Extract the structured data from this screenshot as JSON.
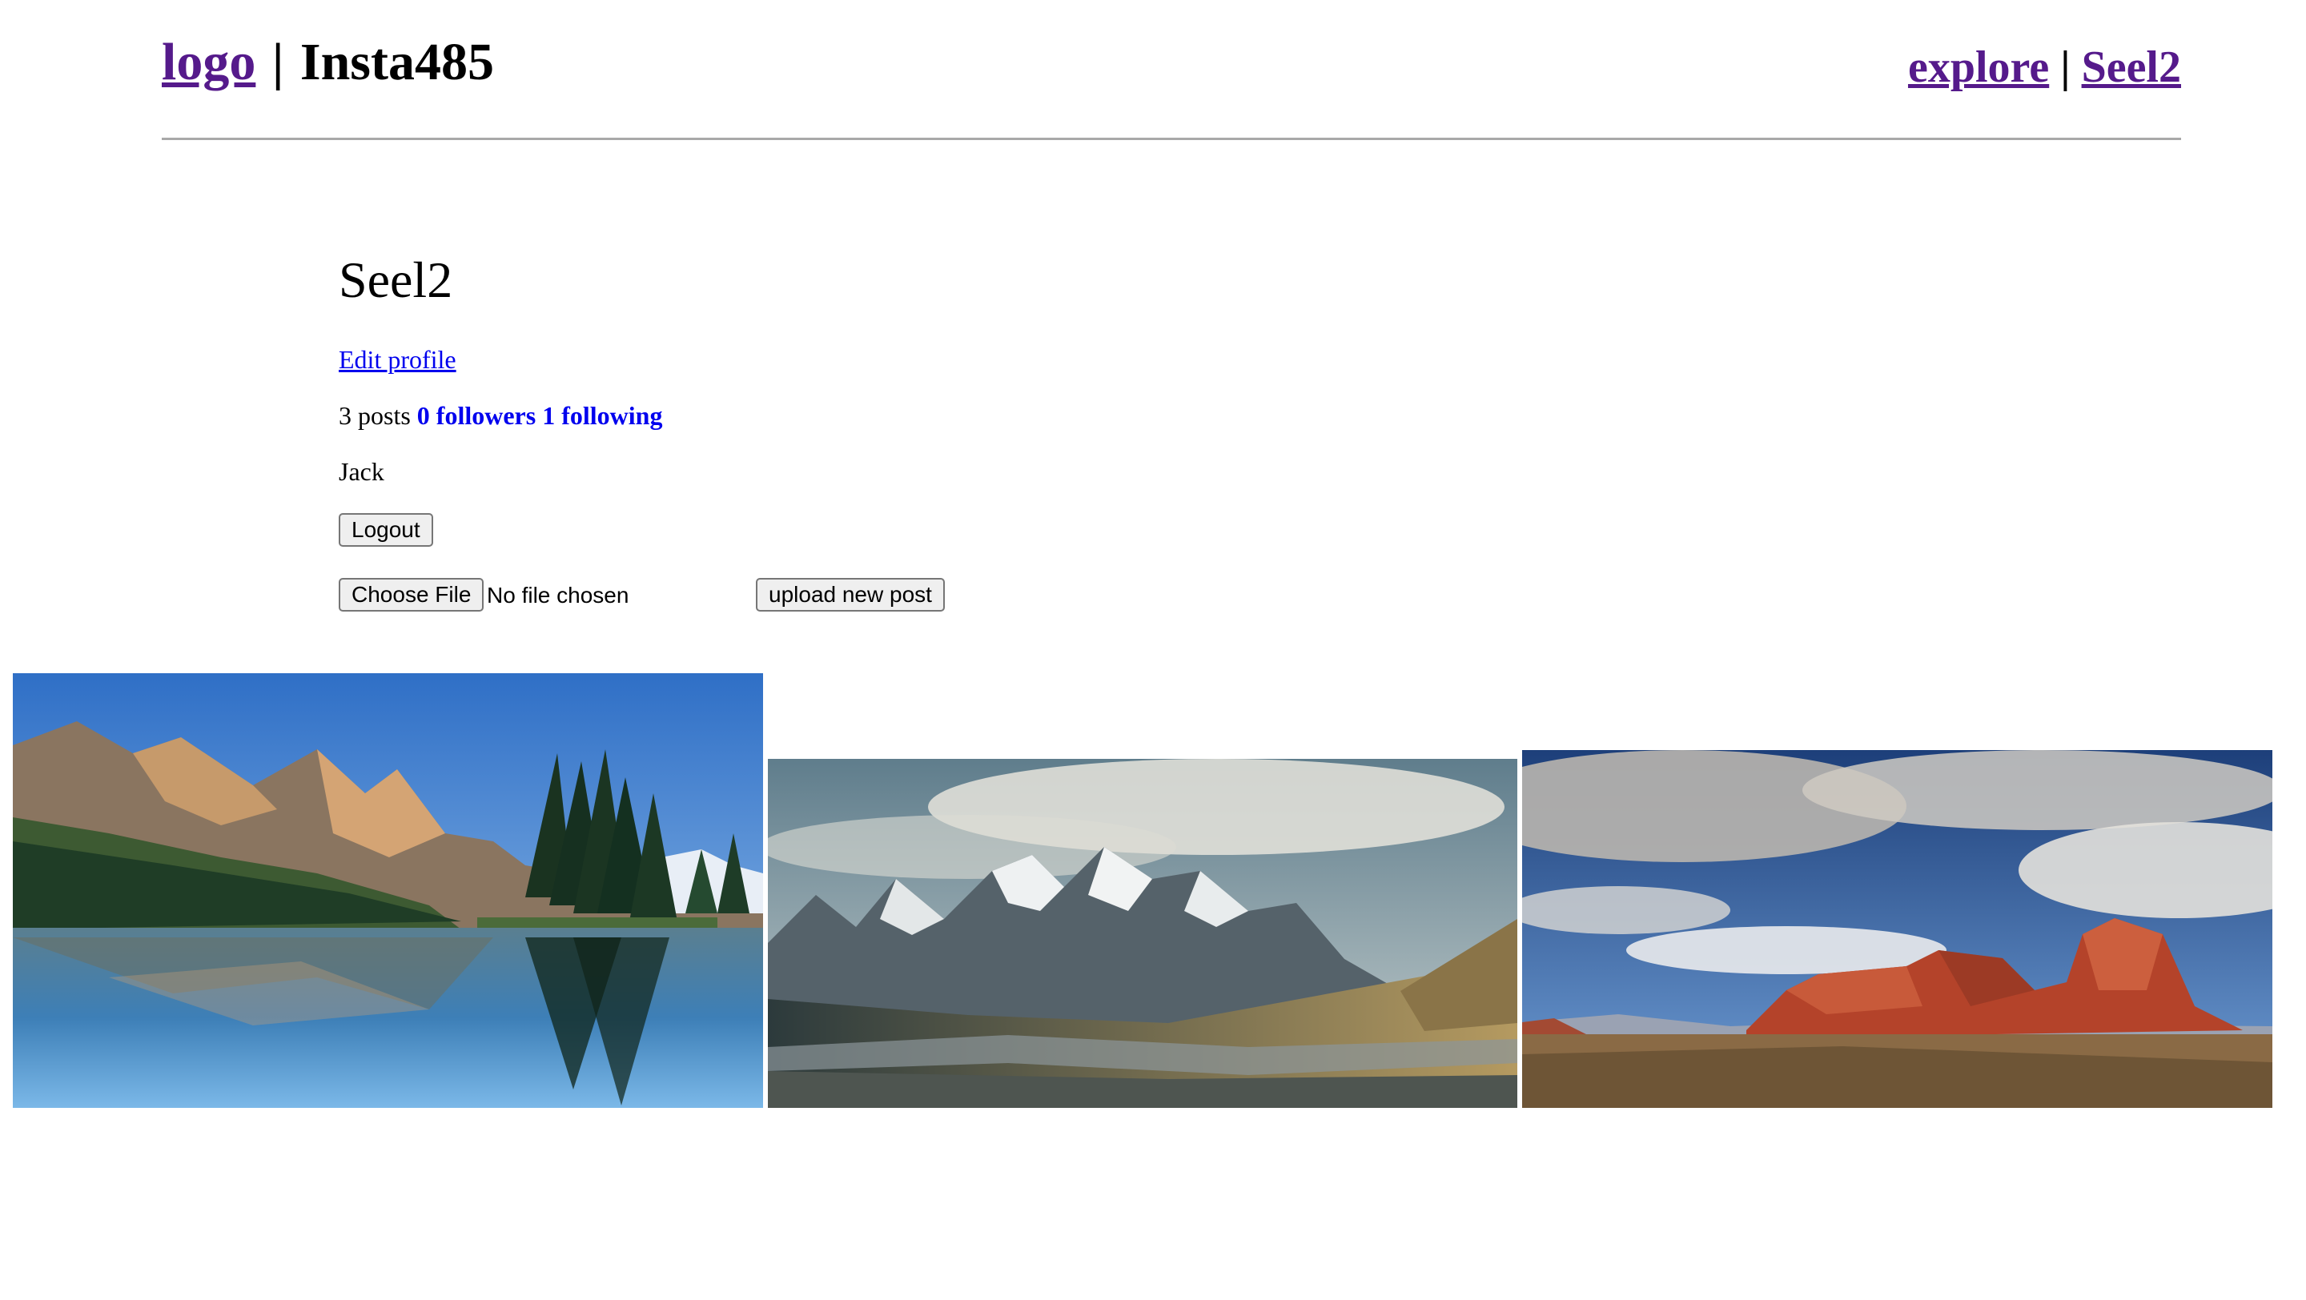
{
  "header": {
    "logo_label": "logo",
    "separator": "|",
    "title": "Insta485",
    "nav": {
      "explore_label": "explore",
      "separator": "|",
      "user_label": "Seel2"
    }
  },
  "profile": {
    "username": "Seel2",
    "edit_profile_label": "Edit profile",
    "posts_text": "3 posts",
    "followers_text": "0 followers",
    "following_text": "1 following",
    "fullname": "Jack",
    "logout_label": "Logout",
    "upload": {
      "choose_file_label": "Choose File",
      "file_status": "No file chosen",
      "submit_label": "upload new post"
    }
  },
  "posts": [
    {
      "image": "mountain-lake-reflection-photo"
    },
    {
      "image": "snowy-mountain-valley-photo"
    },
    {
      "image": "red-rock-mesa-photo"
    }
  ],
  "colors": {
    "link_visited": "#551a8b",
    "link_unvisited": "#0000ee",
    "divider": "#a9a9a9"
  }
}
